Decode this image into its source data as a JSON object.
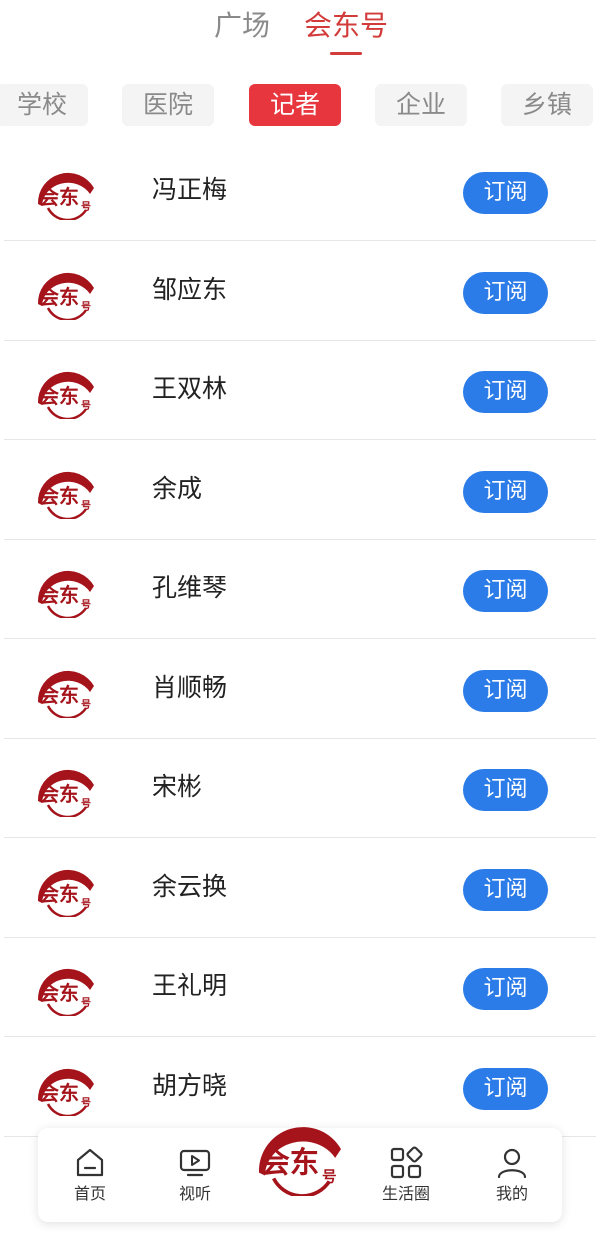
{
  "top_tabs": [
    "广场",
    "会东号"
  ],
  "categories": [
    "学校",
    "医院",
    "记者",
    "企业",
    "乡镇"
  ],
  "subscribe_label": "订阅",
  "logo_text": "会东号",
  "accounts": [
    "冯正梅",
    "邹应东",
    "王双林",
    "余成",
    "孔维琴",
    "肖顺畅",
    "宋彬",
    "余云换",
    "王礼明",
    "胡方晓"
  ],
  "tabbar": {
    "items": [
      {
        "label": "首页",
        "icon": "home-icon"
      },
      {
        "label": "视听",
        "icon": "video-icon"
      },
      {
        "label": "生活圈",
        "icon": "apps-icon"
      },
      {
        "label": "我的",
        "icon": "user-icon"
      }
    ]
  },
  "colors": {
    "brand_red": "#d33a3a",
    "active_category": "#e8363f",
    "subscribe_blue": "#2b7ce8",
    "logo_red": "#a5131b"
  }
}
